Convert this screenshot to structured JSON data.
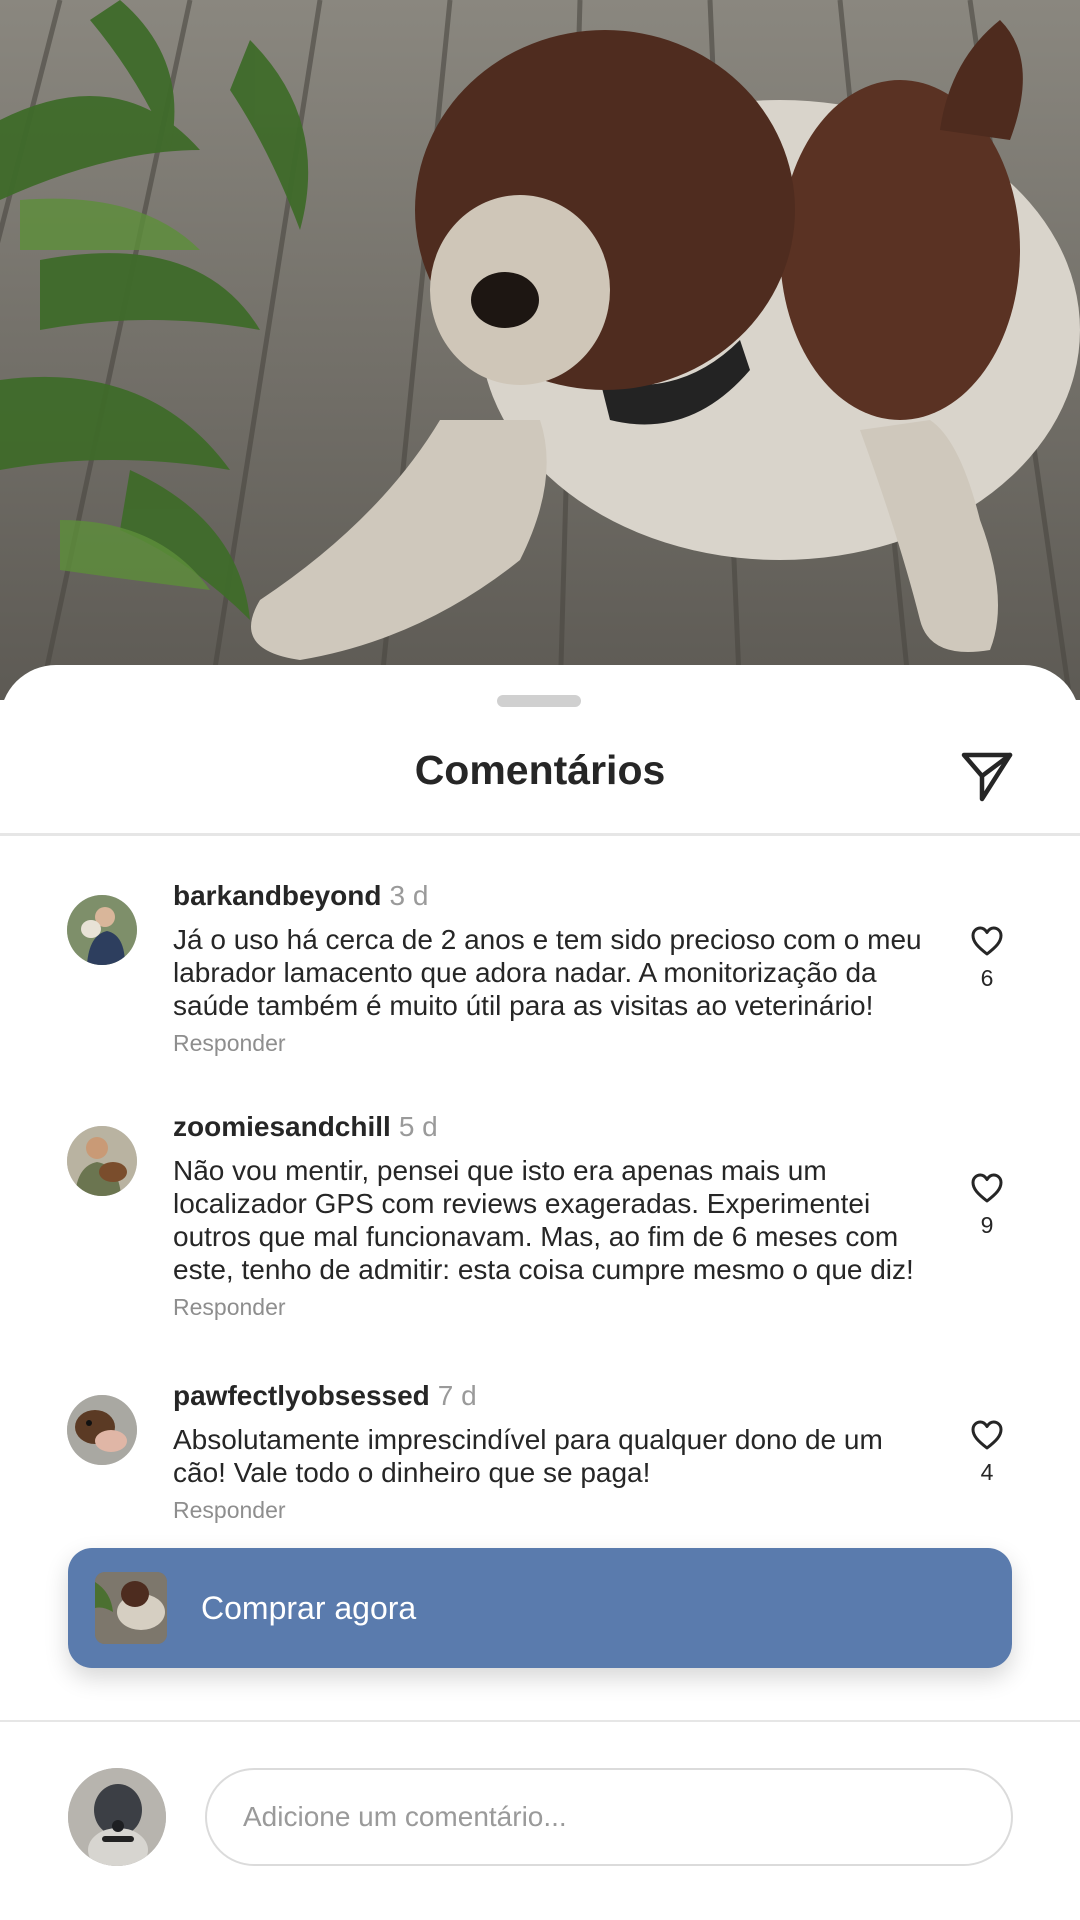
{
  "photo": {
    "subject": "dog-photo"
  },
  "sheet": {
    "title": "Comentários",
    "share_icon": "send-icon"
  },
  "comments": [
    {
      "username": "barkandbeyond",
      "time": "3 d",
      "text": "Já o uso há cerca de 2 anos e tem sido precioso com o meu labrador lamacento que adora nadar. A monitorização da saúde também é muito útil para as visitas ao veterinário!",
      "reply_label": "Responder",
      "likes": "6"
    },
    {
      "username": "zoomiesandchill",
      "time": "5 d",
      "text": "Não vou mentir, pensei que isto era apenas mais um localizador GPS com reviews exageradas. Experimentei outros que mal funcionavam. Mas, ao fim de 6 meses com este, tenho de admitir: esta coisa cumpre mesmo o que diz!",
      "reply_label": "Responder",
      "likes": "9"
    },
    {
      "username": "pawfectlyobsessed",
      "time": "7 d",
      "text": "Absolutamente imprescindível para qualquer dono de um cão! Vale todo o dinheiro que se paga!",
      "reply_label": "Responder",
      "likes": "4"
    }
  ],
  "cta": {
    "label": "Comprar agora",
    "color": "#5a7bad"
  },
  "composer": {
    "placeholder": "Adicione um comentário..."
  }
}
